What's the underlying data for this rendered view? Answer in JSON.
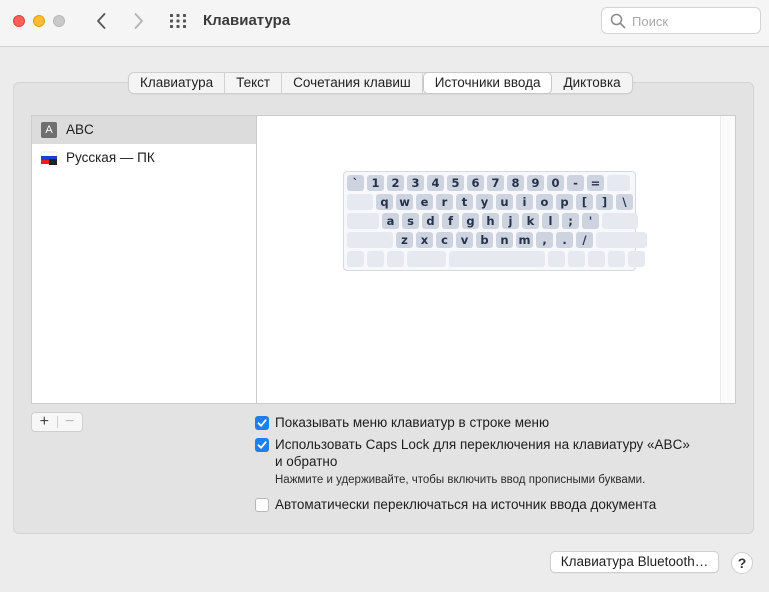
{
  "window": {
    "title": "Клавиатура",
    "search_placeholder": "Поиск"
  },
  "tabs": [
    {
      "label": "Клавиатура",
      "active": false
    },
    {
      "label": "Текст",
      "active": false
    },
    {
      "label": "Сочетания клавиш",
      "active": false
    },
    {
      "label": "Источники ввода",
      "active": true
    },
    {
      "label": "Диктовка",
      "active": false
    }
  ],
  "input_sources": [
    {
      "label": "ABC",
      "icon": "A",
      "selected": true
    },
    {
      "label": "Русская — ПК",
      "icon": "russian-flag-icon",
      "selected": false
    }
  ],
  "keyboard": {
    "row1": [
      "`",
      "1",
      "2",
      "3",
      "4",
      "5",
      "6",
      "7",
      "8",
      "9",
      "0",
      "-",
      "="
    ],
    "row2": [
      "q",
      "w",
      "e",
      "r",
      "t",
      "y",
      "u",
      "i",
      "o",
      "p",
      "[",
      "]",
      "\\"
    ],
    "row3": [
      "a",
      "s",
      "d",
      "f",
      "g",
      "h",
      "j",
      "k",
      "l",
      ";",
      "'"
    ],
    "row4": [
      "z",
      "x",
      "c",
      "v",
      "b",
      "n",
      "m",
      ",",
      ".",
      "/"
    ]
  },
  "list_controls": {
    "add": "+",
    "remove": "−"
  },
  "options": {
    "show_menu": {
      "label": "Показывать меню клавиатур в строке меню",
      "checked": true
    },
    "caps_lock": {
      "label_line1": "Использовать Caps Lock для переключения на клавиатуру «ABC»",
      "label_line2": "и обратно",
      "checked": true
    },
    "caps_hint": "Нажмите и удерживайте, чтобы включить ввод прописными буквами.",
    "auto_switch": {
      "label": "Автоматически переключаться на источник ввода документа",
      "checked": false
    }
  },
  "footer": {
    "bluetooth_button": "Клавиатура Bluetooth…",
    "help_button": "?"
  },
  "colors": {
    "accent": "#1f7ef0",
    "close": "#fe5f57",
    "minimize": "#febc2e"
  }
}
